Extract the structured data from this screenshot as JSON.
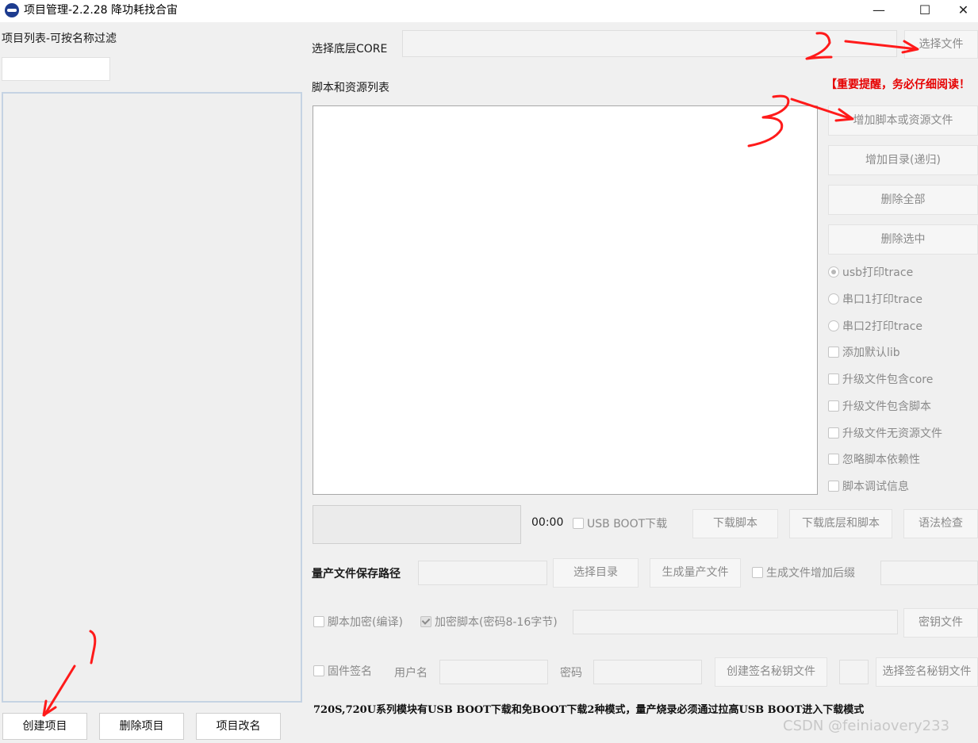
{
  "window": {
    "title": "项目管理-2.2.28 降功耗找合宙",
    "minimize": "—",
    "maximize": "☐",
    "close": "✕"
  },
  "left_panel": {
    "filter_label": "项目列表-可按名称过滤",
    "filter_value": "",
    "create_button": "创建项目",
    "delete_button": "删除项目",
    "rename_button": "项目改名"
  },
  "core": {
    "label": "选择底层CORE",
    "path_value": "",
    "select_button": "选择文件"
  },
  "scripts": {
    "label": "脚本和资源列表",
    "warning": "【重要提醒，务必仔细阅读！",
    "add_file_button": "增加脚本或资源文件",
    "add_dir_button": "增加目录(递归)",
    "delete_all_button": "删除全部",
    "delete_selected_button": "删除选中"
  },
  "options": {
    "radios": [
      {
        "label": "usb打印trace",
        "checked": true
      },
      {
        "label": "串口1打印trace",
        "checked": false
      },
      {
        "label": "串口2打印trace",
        "checked": false
      }
    ],
    "checkboxes": [
      {
        "label": "添加默认lib",
        "checked": false
      },
      {
        "label": "升级文件包含core",
        "checked": false
      },
      {
        "label": "升级文件包含脚本",
        "checked": false
      },
      {
        "label": "升级文件无资源文件",
        "checked": false
      },
      {
        "label": "忽略脚本依赖性",
        "checked": false
      },
      {
        "label": "脚本调试信息",
        "checked": false
      }
    ]
  },
  "download": {
    "progress": 0,
    "time": "00:00",
    "usb_boot_label": "USB BOOT下载",
    "download_script_button": "下载脚本",
    "download_core_script_button": "下载底层和脚本",
    "syntax_check_button": "语法检查"
  },
  "production": {
    "label": "量产文件保存路径",
    "path_value": "",
    "select_dir_button": "选择目录",
    "generate_button": "生成量产文件",
    "suffix_label": "生成文件增加后缀",
    "suffix_value": ""
  },
  "encryption": {
    "compile_label": "脚本加密(编译)",
    "encrypt_label": "加密脚本(密码8-16字节)",
    "encrypt_checked": true,
    "key_value": "",
    "key_button": "密钥文件"
  },
  "signing": {
    "firmware_sign_label": "固件签名",
    "username_label": "用户名",
    "username_value": "",
    "password_label": "密码",
    "password_value": "",
    "create_key_button": "创建签名秘钥文件",
    "select_key_button": "选择签名秘钥文件"
  },
  "notice": "720S,720U系列模块有USB  BOOT下载和免BOOT下载2种模式，量产烧录必须通过拉高USB  BOOT进入下载模式",
  "watermark": "CSDN @feiniaovery233",
  "annotations": {
    "num1": "1",
    "num2": "2",
    "num3": "3",
    "color": "#ff1a1a"
  }
}
